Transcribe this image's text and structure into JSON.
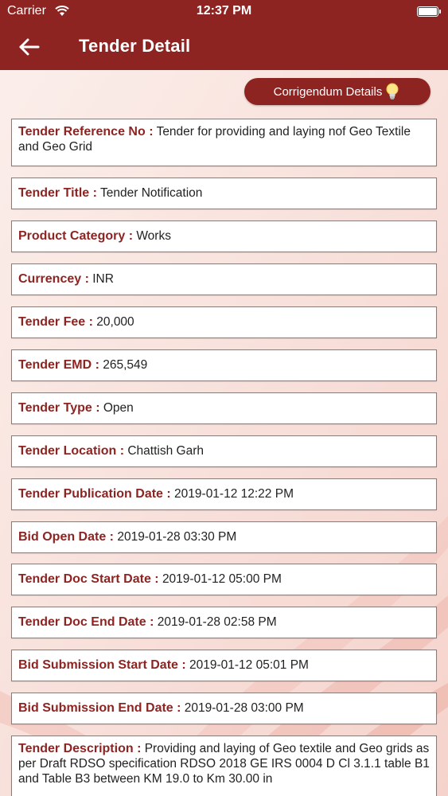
{
  "status_bar": {
    "carrier": "Carrier",
    "time": "12:37 PM"
  },
  "nav": {
    "title": "Tender Detail",
    "back_icon": "arrow-left-icon"
  },
  "corrigendum_button": {
    "label": "Corrigendum Details",
    "icon": "lightbulb-icon"
  },
  "fields": [
    {
      "label": "Tender Reference No :",
      "value": "Tender for providing and laying nof Geo Textile and Geo Grid"
    },
    {
      "label": "Tender Title :",
      "value": "Tender Notification"
    },
    {
      "label": "Product Category :",
      "value": "Works"
    },
    {
      "label": "Currencey :",
      "value": "INR"
    },
    {
      "label": "Tender Fee :",
      "value": "20,000"
    },
    {
      "label": "Tender EMD :",
      "value": "265,549"
    },
    {
      "label": "Tender Type :",
      "value": "Open"
    },
    {
      "label": "Tender Location :",
      "value": "Chattish Garh"
    },
    {
      "label": "Tender Publication Date :",
      "value": "2019-01-12 12:22 PM"
    },
    {
      "label": "Bid Open Date :",
      "value": "2019-01-28 03:30 PM"
    },
    {
      "label": "Tender Doc Start Date :",
      "value": "2019-01-12 05:00 PM"
    },
    {
      "label": "Tender Doc End Date :",
      "value": "2019-01-28 02:58 PM"
    },
    {
      "label": "Bid Submission Start Date :",
      "value": "2019-01-12 05:01 PM"
    },
    {
      "label": "Bid Submission End Date :",
      "value": "2019-01-28 03:00 PM"
    },
    {
      "label": "Tender Description :",
      "value": "Providing and laying of Geo textile and Geo grids as per Draft RDSO specification RDSO 2018 GE IRS 0004 D Cl 3.1.1 table B1 and Table B3 between KM 19.0 to Km 30.00 in"
    }
  ],
  "colors": {
    "brand": "#8e2422",
    "background": "#fbeeea"
  }
}
